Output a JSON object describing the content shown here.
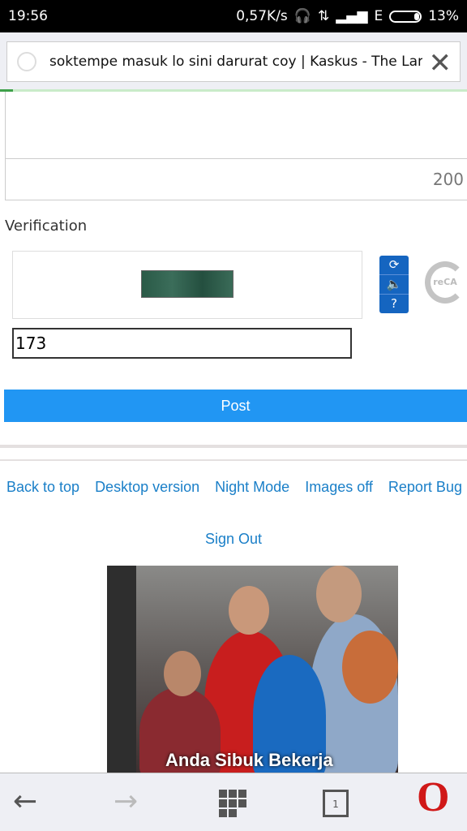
{
  "status": {
    "time": "19:56",
    "speed": "0,57K/s",
    "network": "E",
    "battery": "13%"
  },
  "address": {
    "title": "soktempe masuk lo sini darurat coy | Kaskus - The Largest Indonesian Community"
  },
  "form": {
    "counter": "200",
    "verification_label": "Verification",
    "captcha_value": "173",
    "post_label": "Post",
    "recaptcha_logo": "reCAPTCHA"
  },
  "footer": {
    "links": [
      "Back to top",
      "Desktop version",
      "Night Mode",
      "Images off",
      "Report Bug"
    ],
    "sign_out": "Sign Out"
  },
  "ad": {
    "caption": "Anda Sibuk Bekerja"
  },
  "nav": {
    "tab_count": "1"
  },
  "colors": {
    "accent": "#2196f3",
    "link": "#1a7fc8",
    "opera": "#d01818"
  }
}
